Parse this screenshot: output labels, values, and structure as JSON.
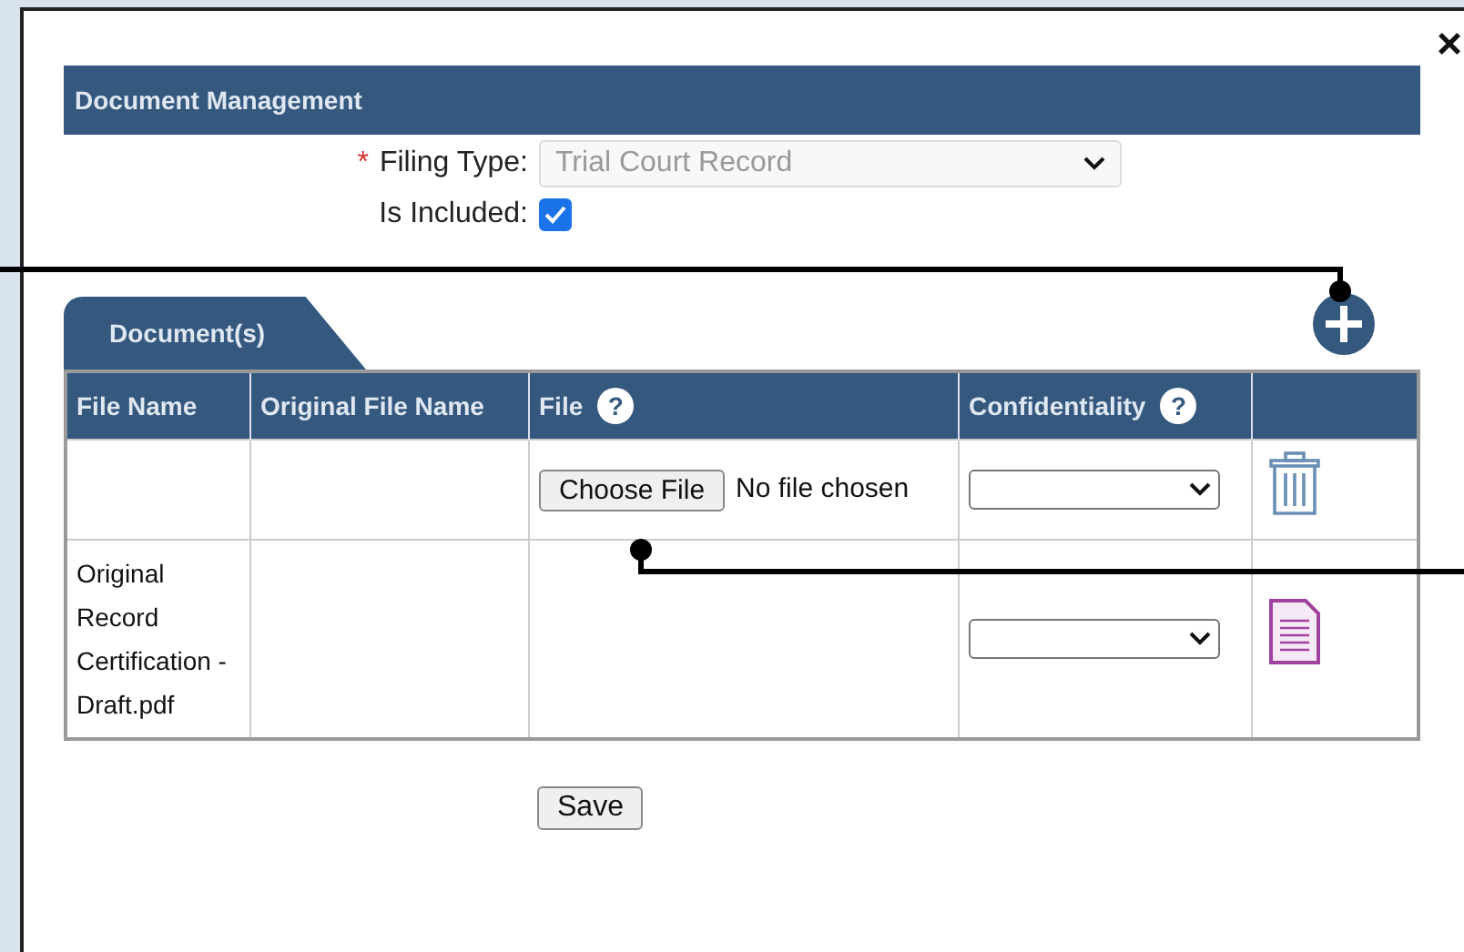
{
  "dialog": {
    "close": "×"
  },
  "section": {
    "title": "Document Management"
  },
  "form": {
    "filing_type": {
      "required_mark": "*",
      "label": "Filing Type:",
      "value": "Trial Court Record",
      "disabled": true
    },
    "is_included": {
      "label": "Is Included:",
      "checked": true
    }
  },
  "tabs": [
    {
      "label": "Document(s)",
      "selected": true
    }
  ],
  "table": {
    "columns": [
      {
        "label": "File Name"
      },
      {
        "label": "Original File Name"
      },
      {
        "label": "File",
        "help": "?"
      },
      {
        "label": "Confidentiality",
        "help": "?"
      },
      {}
    ],
    "rows": [
      {
        "kind": "upload",
        "file_button": "Choose File",
        "file_status": "No file chosen"
      },
      {
        "kind": "document",
        "file_name": "Original Record Certification - Draft.pdf"
      }
    ]
  },
  "save": "Save"
}
